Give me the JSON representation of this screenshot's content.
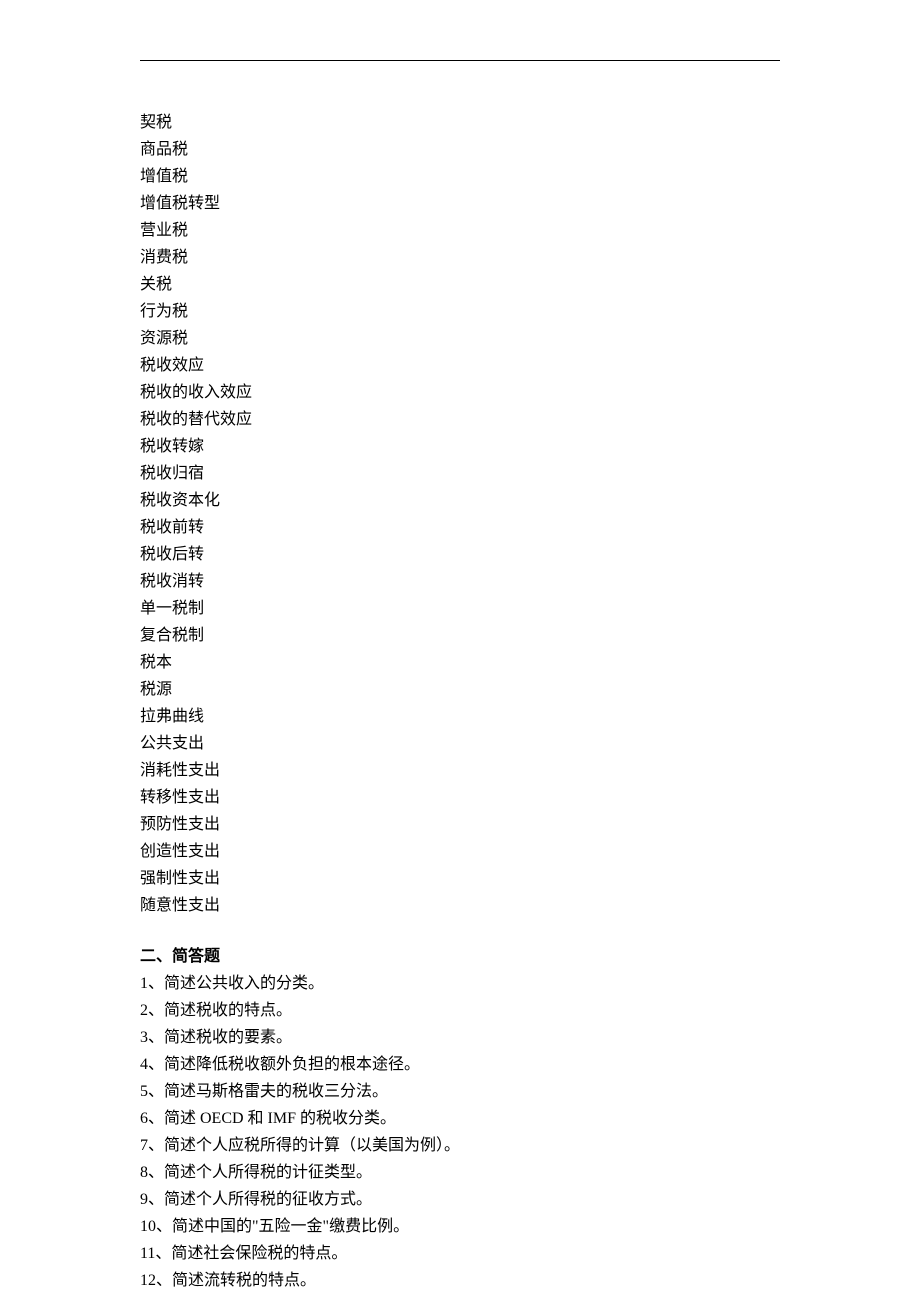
{
  "terms": [
    "契税",
    "商品税",
    "增值税",
    "增值税转型",
    "营业税",
    "消费税",
    "关税",
    "行为税",
    "资源税",
    "税收效应",
    "税收的收入效应",
    "税收的替代效应",
    "税收转嫁",
    "税收归宿",
    "税收资本化",
    "税收前转",
    "税收后转",
    "税收消转",
    "单一税制",
    "复合税制",
    "税本",
    "税源",
    "拉弗曲线",
    "公共支出",
    "消耗性支出",
    "转移性支出",
    "预防性支出",
    "创造性支出",
    "强制性支出",
    "随意性支出"
  ],
  "section2": {
    "heading": "二、简答题",
    "questions": [
      "1、简述公共收入的分类。",
      "2、简述税收的特点。",
      "3、简述税收的要素。",
      "4、简述降低税收额外负担的根本途径。",
      "5、简述马斯格雷夫的税收三分法。",
      "6、简述 OECD 和 IMF 的税收分类。",
      "7、简述个人应税所得的计算（以美国为例）。",
      "8、简述个人所得税的计征类型。",
      "9、简述个人所得税的征收方式。",
      "10、简述中国的\"五险一金\"缴费比例。",
      "11、简述社会保险税的特点。",
      "12、简述流转税的特点。"
    ]
  }
}
